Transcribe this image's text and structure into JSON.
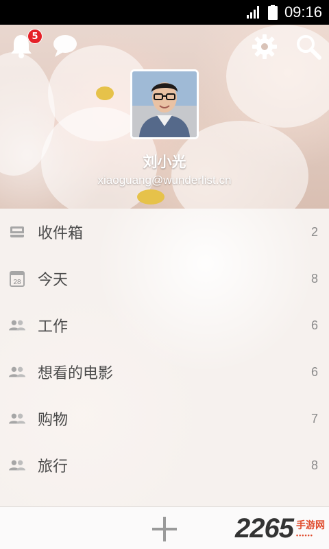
{
  "status_bar": {
    "time": "09:16",
    "signal_icon": "signal-icon",
    "battery_icon": "battery-icon"
  },
  "header": {
    "notification_badge": "5",
    "notifications_icon": "bell-icon",
    "activity_icon": "chat-bubble-icon",
    "settings_icon": "gear-icon",
    "search_icon": "search-icon"
  },
  "profile": {
    "name": "刘小光",
    "email": "xiaoguang@wunderlist.cn"
  },
  "lists": [
    {
      "icon": "inbox-icon",
      "label": "收件箱",
      "count": "2"
    },
    {
      "icon": "calendar-icon",
      "calendar_day": "28",
      "label": "今天",
      "count": "8"
    },
    {
      "icon": "shared-users-icon",
      "label": "工作",
      "count": "6"
    },
    {
      "icon": "shared-users-icon",
      "label": "想看的电影",
      "count": "6"
    },
    {
      "icon": "shared-users-icon",
      "label": "购物",
      "count": "7"
    },
    {
      "icon": "shared-users-icon",
      "label": "旅行",
      "count": "8"
    }
  ],
  "bottom_bar": {
    "add_icon": "plus-icon",
    "watermark": {
      "number": "2265",
      "domain_label": "手游网"
    }
  },
  "colors": {
    "badge": "#e52128",
    "text": "#4a4a4a",
    "count": "#8a8a8a",
    "watermark_accent": "#e04b2c"
  }
}
